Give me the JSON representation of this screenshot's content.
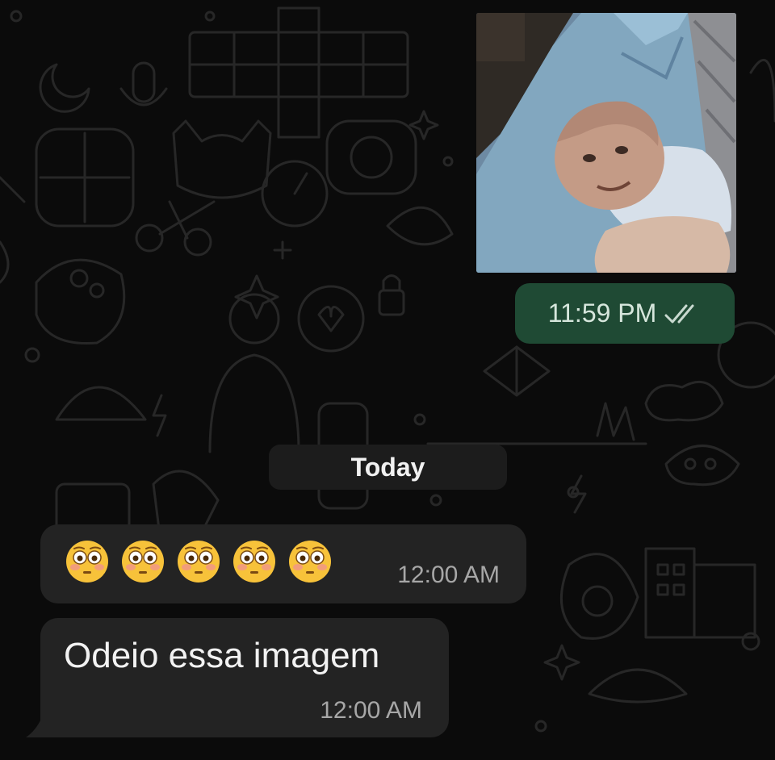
{
  "chat": {
    "sent_image": {
      "time": "11:59 PM",
      "status_icon": "double-check-icon",
      "bubble_color": "#1f4a34"
    },
    "date_separator": "Today",
    "received_messages": [
      {
        "content": "😳😳😳😳😳",
        "emoji_count": 5,
        "emoji_icon": "flushed-face-emoji",
        "time": "12:00 AM"
      },
      {
        "content": "Odeio essa imagem",
        "time": "12:00 AM"
      }
    ],
    "incoming_bubble_color": "#232323",
    "background_color": "#0b0b0b"
  }
}
